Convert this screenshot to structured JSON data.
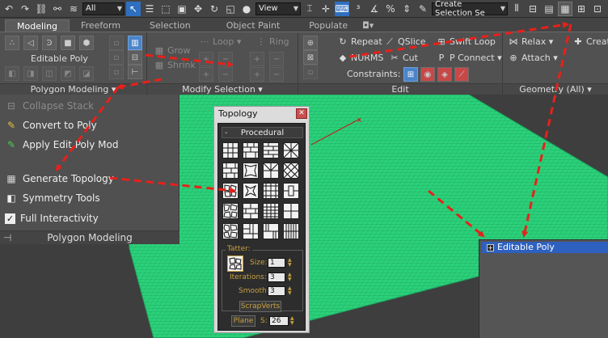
{
  "toolbar": {
    "selection_filter": "All",
    "reference_coord": "View",
    "named_selection": "Create Selection Se"
  },
  "ribbon": {
    "tabs": [
      "Modeling",
      "Freeform",
      "Selection",
      "Object Paint",
      "Populate"
    ],
    "polygon_modeling": {
      "object_label": "Editable Poly",
      "title": "Polygon Modeling"
    },
    "modify_selection": {
      "grow": "Grow",
      "shrink": "Shrink",
      "loop": "Loop",
      "ring": "Ring",
      "title": "Modify Selection"
    },
    "edit": {
      "repeat": "Repeat",
      "qslice": "QSlice",
      "swift_loop": "Swift Loop",
      "nurms": "NURMS",
      "cut": "Cut",
      "p_connect": "P Connect",
      "constraints": "Constraints:",
      "title": "Edit"
    },
    "geometry": {
      "relax": "Relax",
      "attach": "Attach",
      "create": "Create",
      "title": "Geometry (All)"
    }
  },
  "left_panel": {
    "items": [
      {
        "label": "Collapse Stack",
        "icon": "collapse-stack-icon"
      },
      {
        "label": "Convert to Poly",
        "icon": "convert-poly-icon"
      },
      {
        "label": "Apply Edit Poly Mod",
        "icon": "edit-poly-mod-icon"
      },
      {
        "label": "Generate Topology",
        "icon": "generate-topology-icon"
      },
      {
        "label": "Symmetry Tools",
        "icon": "symmetry-icon"
      },
      {
        "label": "Full Interactivity",
        "icon": "checkbox-icon"
      }
    ],
    "footer": "Polygon Modeling"
  },
  "topology": {
    "title": "Topology",
    "section": "Procedural",
    "tatter_label": "Tatter:",
    "size_label": "Size:",
    "size_value": "1",
    "iterations_label": "Iterations:",
    "iterations_value": "3",
    "smooth_label": "Smooth:",
    "smooth_value": "3",
    "scrapverts": "ScrapVerts",
    "plane": "Plane",
    "s_label": "S:",
    "s_value": "26"
  },
  "modifier_stack": {
    "item": "Editable Poly"
  },
  "colors": {
    "plane_green": "#2bd17a",
    "arrow_red": "#e8201a",
    "selection_blue": "#2e60bf"
  }
}
